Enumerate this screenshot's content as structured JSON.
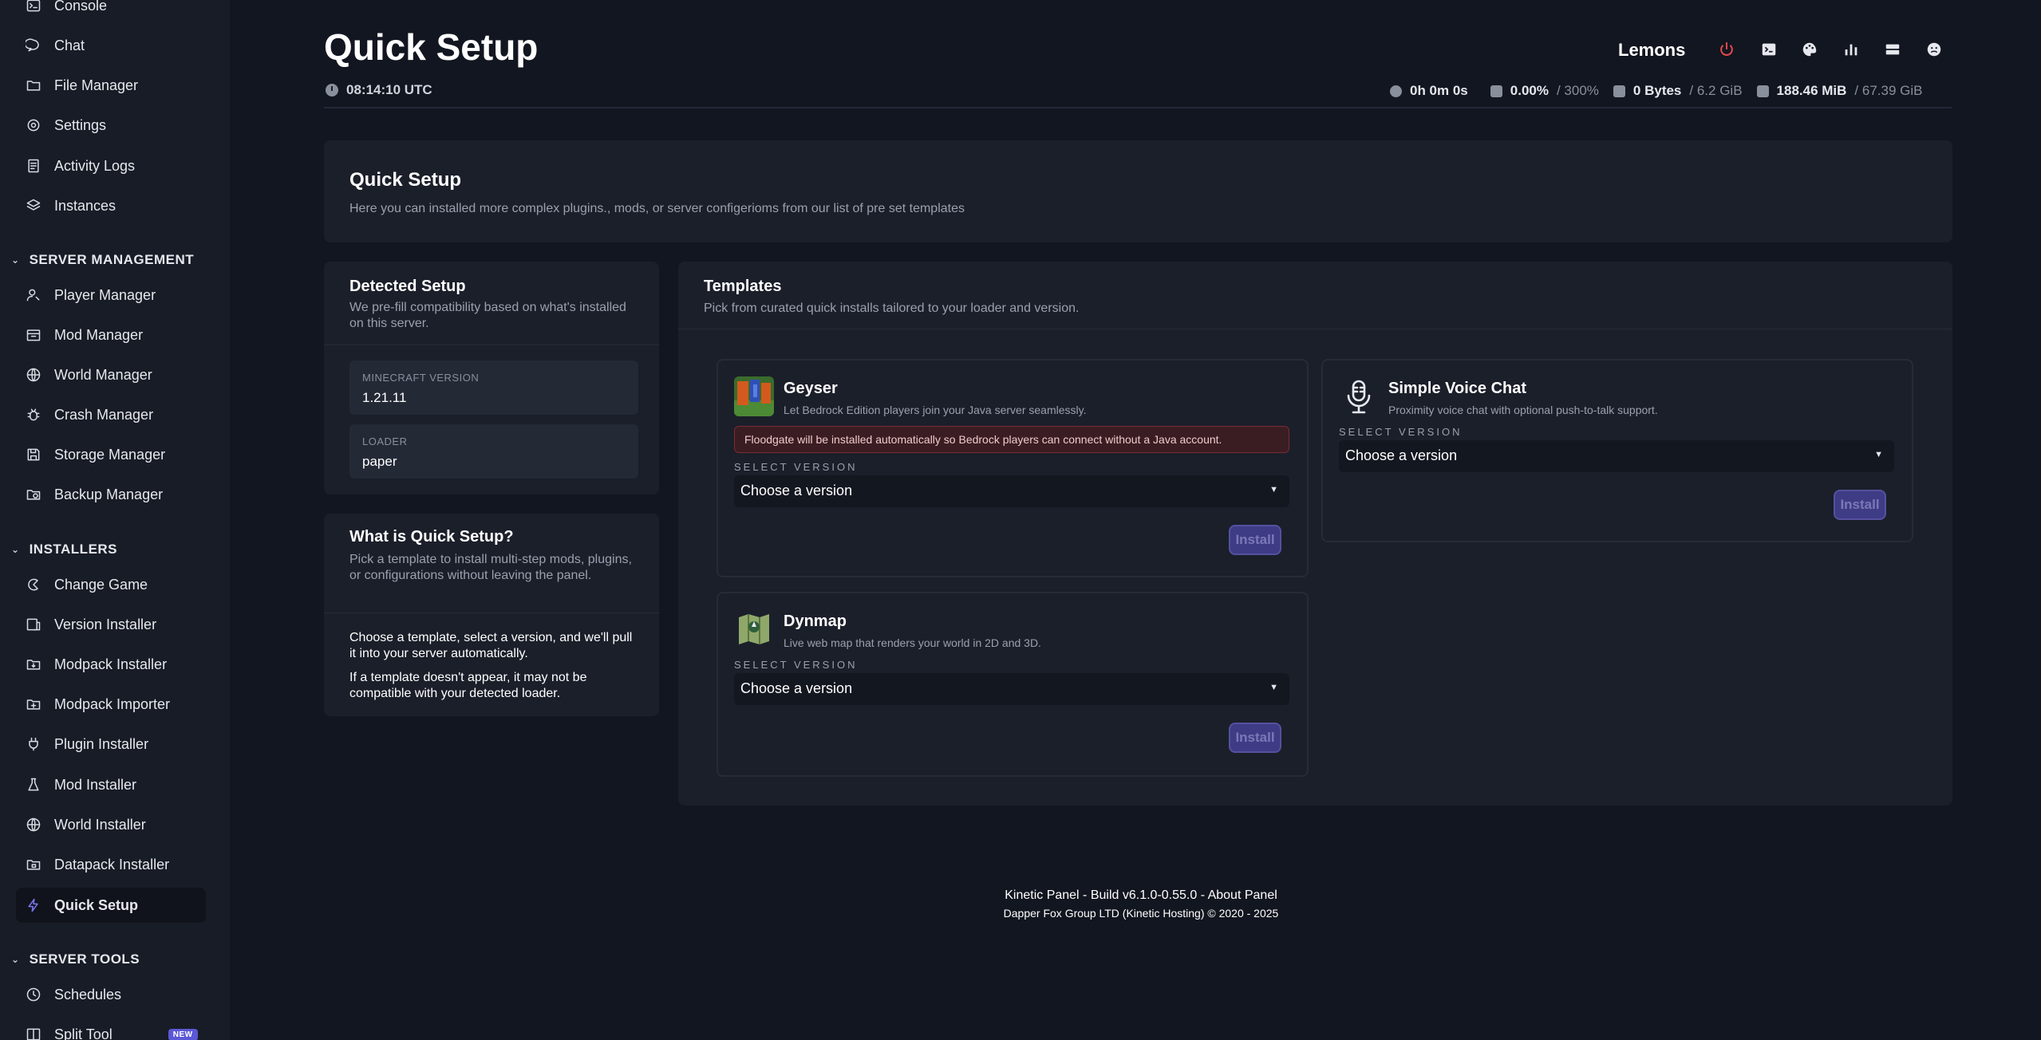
{
  "sidebar": {
    "items_top": [
      {
        "label": "Console",
        "icon": "terminal-icon"
      },
      {
        "label": "Chat",
        "icon": "chat-icon"
      },
      {
        "label": "File Manager",
        "icon": "folder-icon"
      },
      {
        "label": "Settings",
        "icon": "gear-icon"
      },
      {
        "label": "Activity Logs",
        "icon": "logs-icon"
      },
      {
        "label": "Instances",
        "icon": "layers-icon"
      }
    ],
    "section_server_management": "SERVER MANAGEMENT",
    "items_management": [
      {
        "label": "Player Manager",
        "icon": "user-gear-icon"
      },
      {
        "label": "Mod Manager",
        "icon": "box-icon"
      },
      {
        "label": "World Manager",
        "icon": "globe-icon"
      },
      {
        "label": "Crash Manager",
        "icon": "bug-icon"
      },
      {
        "label": "Storage Manager",
        "icon": "save-icon"
      },
      {
        "label": "Backup Manager",
        "icon": "folder-clock-icon"
      }
    ],
    "section_installers": "INSTALLERS",
    "items_installers": [
      {
        "label": "Change Game",
        "icon": "game-icon"
      },
      {
        "label": "Version Installer",
        "icon": "version-icon"
      },
      {
        "label": "Modpack Installer",
        "icon": "folder-down-icon"
      },
      {
        "label": "Modpack Importer",
        "icon": "folder-import-icon"
      },
      {
        "label": "Plugin Installer",
        "icon": "plug-icon"
      },
      {
        "label": "Mod Installer",
        "icon": "flask-icon"
      },
      {
        "label": "World Installer",
        "icon": "globe-icon"
      },
      {
        "label": "Datapack Installer",
        "icon": "folder-data-icon"
      },
      {
        "label": "Quick Setup",
        "icon": "bolt-icon"
      }
    ],
    "section_server_tools": "SERVER TOOLS",
    "items_tools": [
      {
        "label": "Schedules",
        "icon": "clock-icon"
      },
      {
        "label": "Split Tool",
        "icon": "split-icon",
        "badge": "NEW"
      }
    ]
  },
  "header": {
    "title": "Quick Setup",
    "time": "08:14:10 UTC",
    "server_name": "Lemons",
    "uptime": "0h 0m 0s",
    "cpu": "0.00%",
    "cpu_limit": "/ 300%",
    "memory": "0 Bytes",
    "memory_limit": "/ 6.2 GiB",
    "disk": "188.46 MiB",
    "disk_limit": "/ 67.39 GiB"
  },
  "intro": {
    "title": "Quick Setup",
    "description": "Here you can installed more complex plugins., mods, or server configerioms from our list of pre set templates"
  },
  "detected": {
    "title": "Detected Setup",
    "description": "We pre-fill compatibility based on what's installed on this server.",
    "mc_label": "MINECRAFT VERSION",
    "mc_value": "1.21.11",
    "loader_label": "LOADER",
    "loader_value": "paper"
  },
  "whatis": {
    "title": "What is Quick Setup?",
    "description": "Pick a template to install multi-step mods, plugins, or configurations without leaving the panel.",
    "tip1": "Choose a template, select a version, and we'll pull it into your server automatically.",
    "tip2": "If a template doesn't appear, it may not be compatible with your detected loader."
  },
  "templates": {
    "title": "Templates",
    "subtitle": "Pick from curated quick installs tailored to your loader and version.",
    "select_label": "SELECT VERSION",
    "select_placeholder": "Choose a version",
    "install_label": "Install",
    "items": [
      {
        "name": "Geyser",
        "description": "Let Bedrock Edition players join your Java server seamlessly.",
        "warning": "Floodgate will be installed automatically so Bedrock players can connect without a Java account."
      },
      {
        "name": "Simple Voice Chat",
        "description": "Proximity voice chat with optional push-to-talk support."
      },
      {
        "name": "Dynmap",
        "description": "Live web map that renders your world in 2D and 3D."
      }
    ]
  },
  "footer": {
    "line1": "Kinetic Panel - Build v6.1.0-0.55.0 - About Panel",
    "line2": "Dapper Fox Group LTD (Kinetic Hosting) © 2020 - 2025"
  },
  "colors": {
    "background": "#121620",
    "sidebar": "#181c26",
    "card": "#1b1f2a",
    "accent": "#5b57d6",
    "danger": "#e5484d"
  }
}
